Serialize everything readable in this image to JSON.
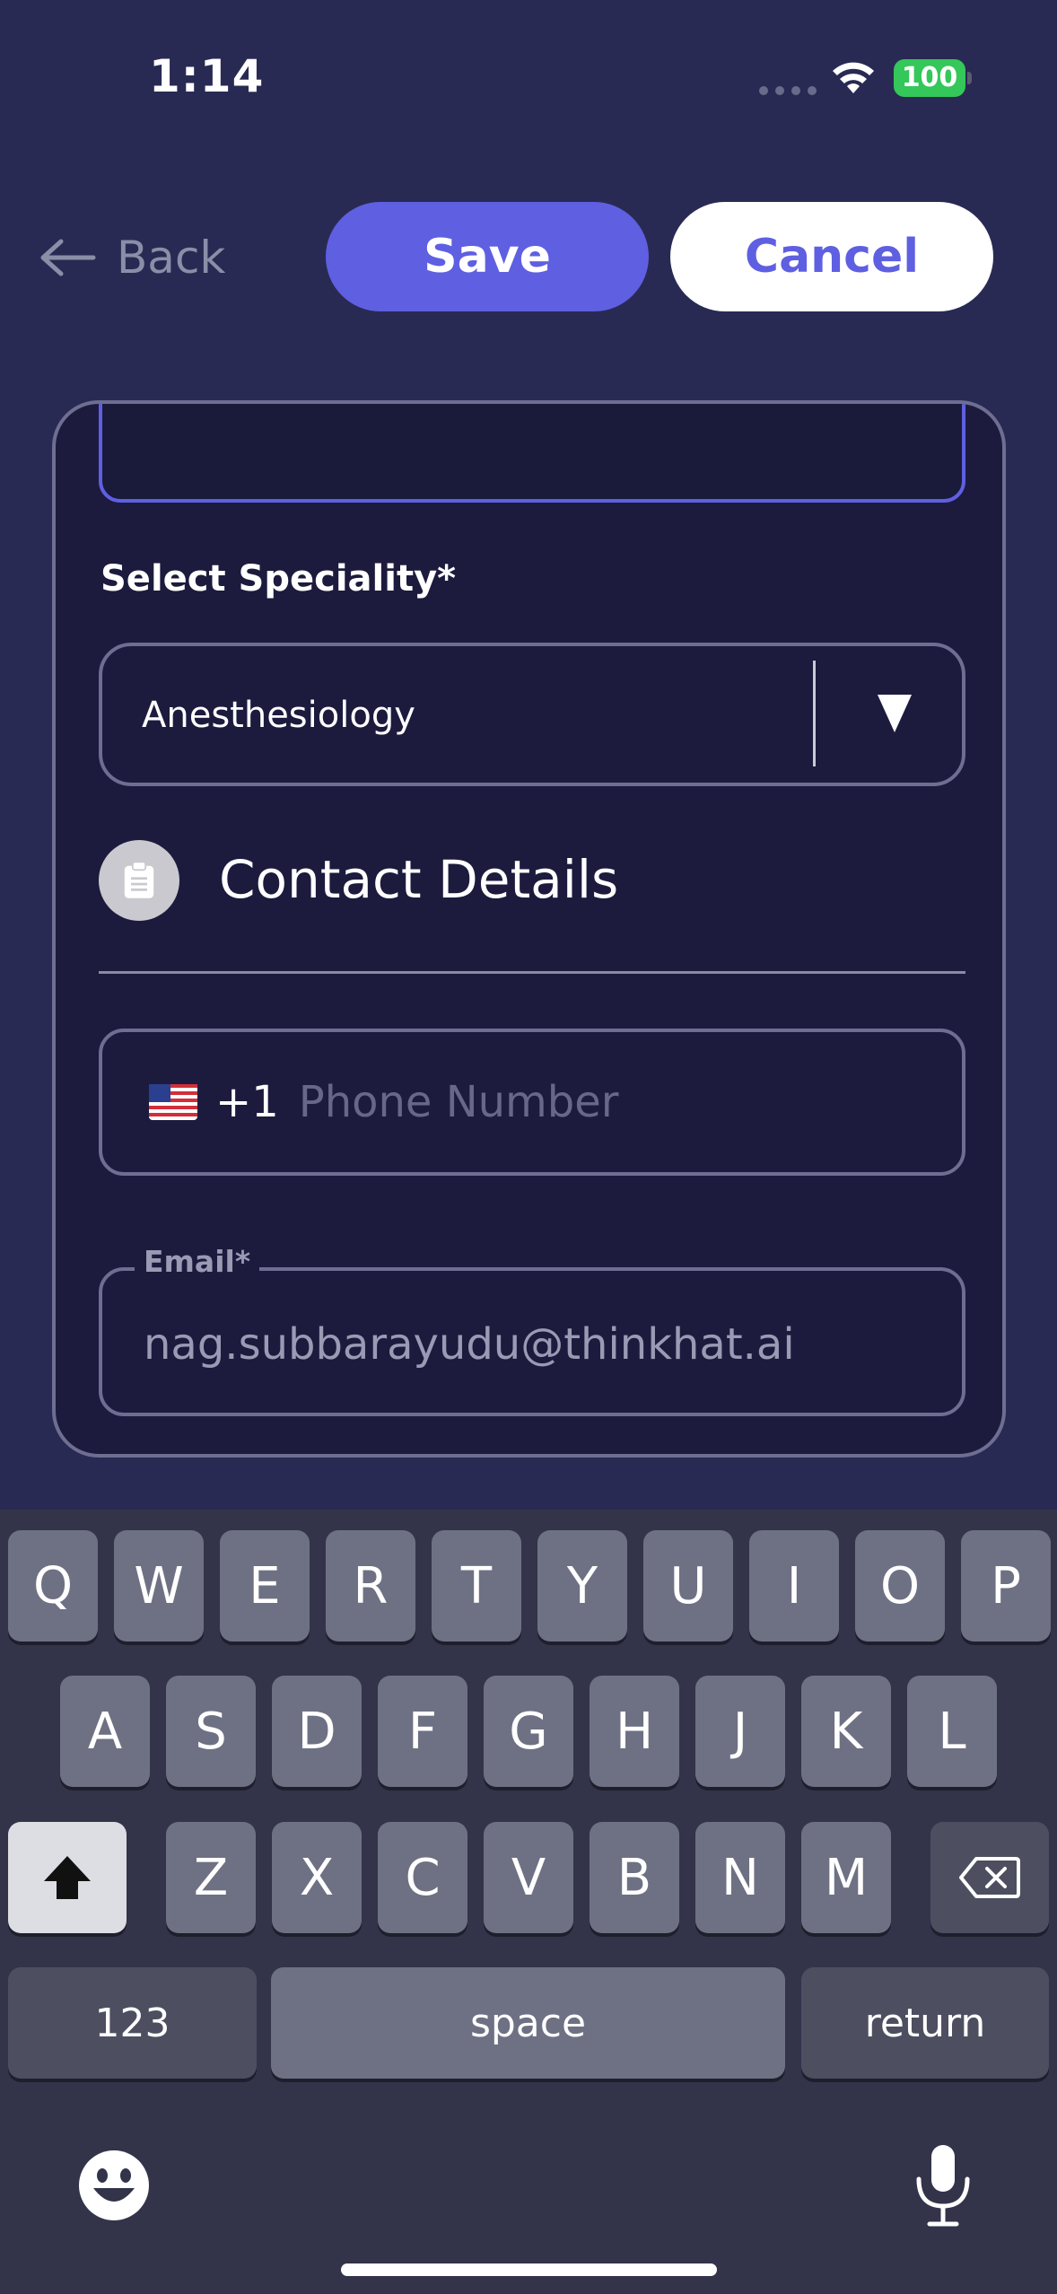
{
  "status_bar": {
    "time": "1:14",
    "battery": "100"
  },
  "header": {
    "back_label": "Back",
    "save_label": "Save",
    "cancel_label": "Cancel"
  },
  "form": {
    "speciality_label": "Select Speciality*",
    "speciality_value": "Anesthesiology",
    "contact_section_title": "Contact Details",
    "phone": {
      "country_code": "+1",
      "placeholder": "Phone Number"
    },
    "email": {
      "label": "Email*",
      "value": "nag.subbarayudu@thinkhat.ai"
    }
  },
  "keyboard": {
    "row1": [
      "Q",
      "W",
      "E",
      "R",
      "T",
      "Y",
      "U",
      "I",
      "O",
      "P"
    ],
    "row2": [
      "A",
      "S",
      "D",
      "F",
      "G",
      "H",
      "J",
      "K",
      "L"
    ],
    "row3": [
      "Z",
      "X",
      "C",
      "V",
      "B",
      "N",
      "M"
    ],
    "numbers_label": "123",
    "space_label": "space",
    "return_label": "return"
  },
  "colors": {
    "background": "#292a53",
    "card": "#1c1b3e",
    "accent": "#5f5fe2",
    "keyboard": "#33344a"
  }
}
